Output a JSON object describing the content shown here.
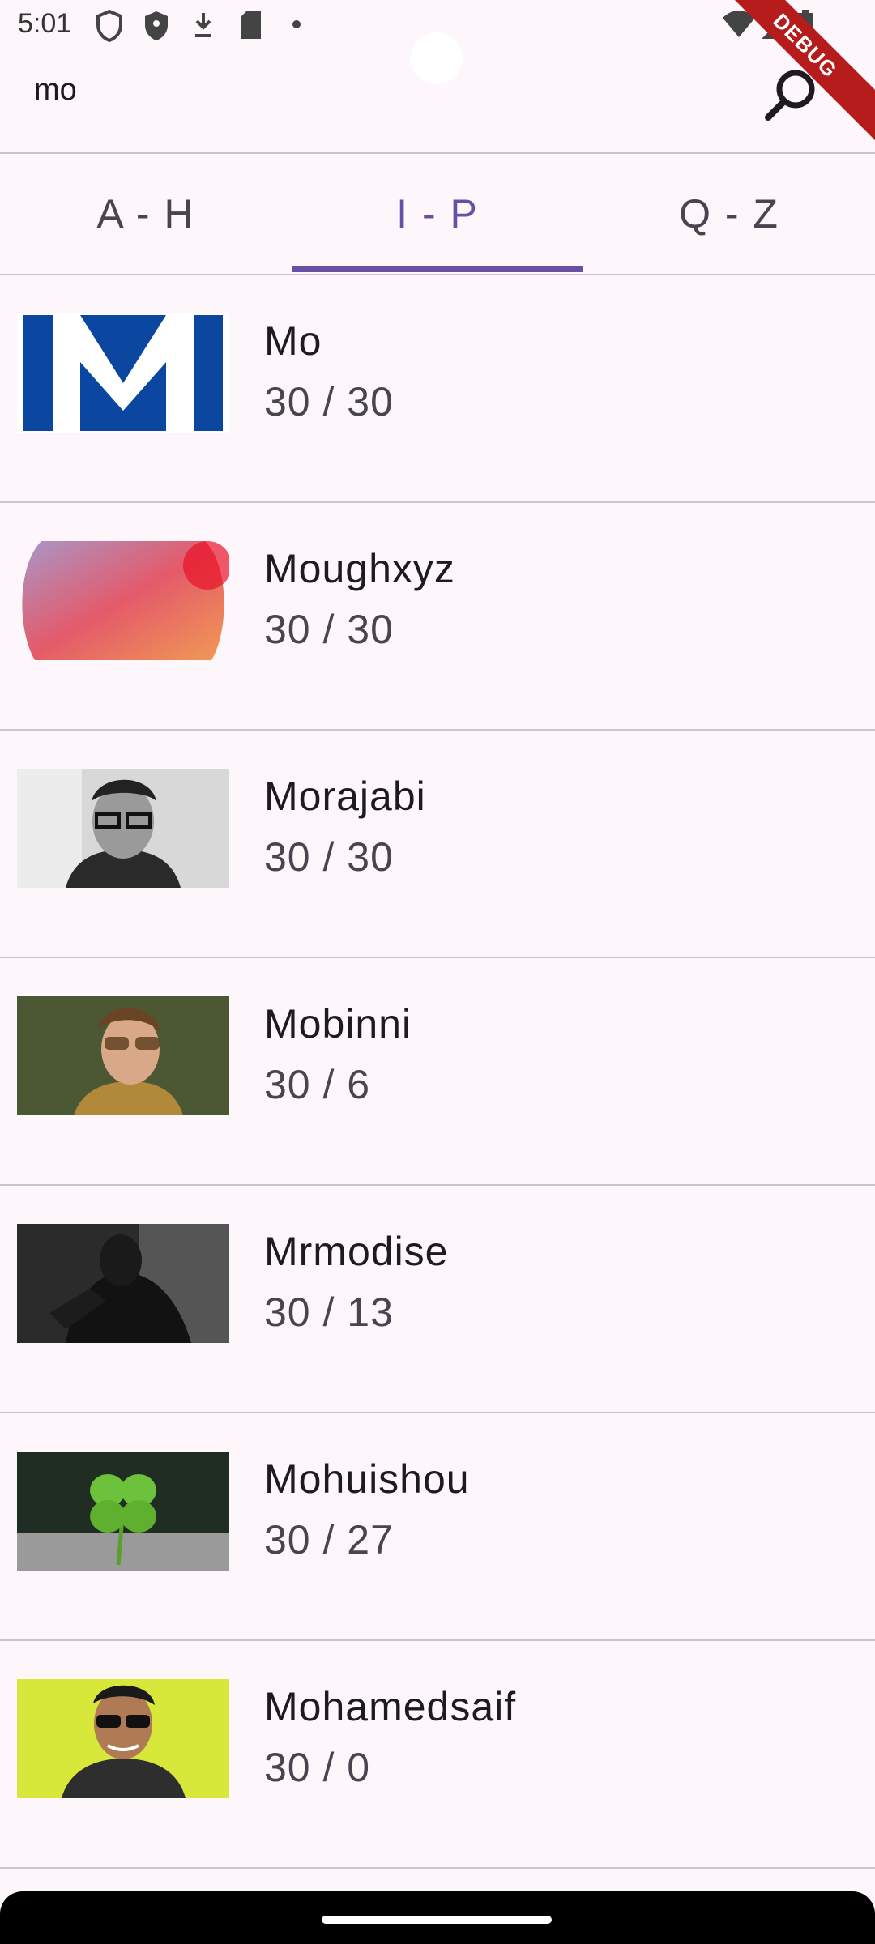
{
  "status_bar": {
    "time": "5:01"
  },
  "debug_banner": "DEBUG",
  "search": {
    "query": "mo"
  },
  "tabs": [
    {
      "label": "A - H",
      "active": false
    },
    {
      "label": "I - P",
      "active": true
    },
    {
      "label": "Q - Z",
      "active": false
    }
  ],
  "items": [
    {
      "name": "Mo",
      "count": "30 / 30"
    },
    {
      "name": "Moughxyz",
      "count": "30 / 30"
    },
    {
      "name": "Morajabi",
      "count": "30 / 30"
    },
    {
      "name": "Mobinni",
      "count": "30 / 6"
    },
    {
      "name": "Mrmodise",
      "count": "30 / 13"
    },
    {
      "name": "Mohuishou",
      "count": "30 / 27"
    },
    {
      "name": "Mohamedsaif",
      "count": "30 / 0"
    }
  ],
  "colors": {
    "accent": "#6750a4",
    "background": "#fdf7fc",
    "divider": "#cac4d0"
  }
}
